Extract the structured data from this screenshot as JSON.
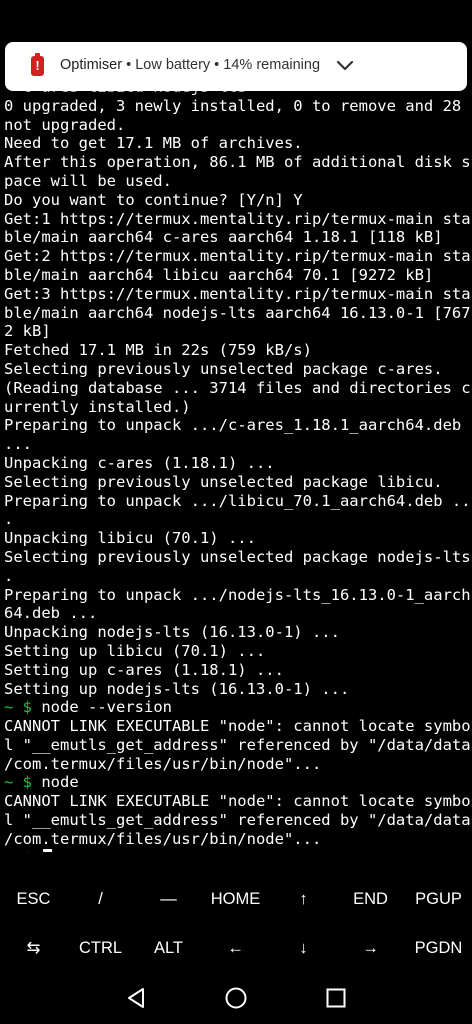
{
  "notification": {
    "app": "Optimiser",
    "separator": " • ",
    "message": "Low battery",
    "detail": "14% remaining",
    "battery_glyph": "!"
  },
  "terminal": {
    "lines": [
      "  c-ares libicu nodejs-lts",
      "0 upgraded, 3 newly installed, 0 to remove and 28",
      "not upgraded.",
      "Need to get 17.1 MB of archives.",
      "After this operation, 86.1 MB of additional disk s",
      "pace will be used.",
      "Do you want to continue? [Y/n] Y",
      "Get:1 https://termux.mentality.rip/termux-main sta",
      "ble/main aarch64 c-ares aarch64 1.18.1 [118 kB]",
      "Get:2 https://termux.mentality.rip/termux-main sta",
      "ble/main aarch64 libicu aarch64 70.1 [9272 kB]",
      "Get:3 https://termux.mentality.rip/termux-main sta",
      "ble/main aarch64 nodejs-lts aarch64 16.13.0-1 [767",
      "2 kB]",
      "Fetched 17.1 MB in 22s (759 kB/s)",
      "Selecting previously unselected package c-ares.",
      "(Reading database ... 3714 files and directories c",
      "urrently installed.)",
      "Preparing to unpack .../c-ares_1.18.1_aarch64.deb",
      "...",
      "Unpacking c-ares (1.18.1) ...",
      "Selecting previously unselected package libicu.",
      "Preparing to unpack .../libicu_70.1_aarch64.deb ..",
      ".",
      "Unpacking libicu (70.1) ...",
      "Selecting previously unselected package nodejs-lts",
      ".",
      "Preparing to unpack .../nodejs-lts_16.13.0-1_aarch",
      "64.deb ...",
      "Unpacking nodejs-lts (16.13.0-1) ...",
      "Setting up libicu (70.1) ...",
      "Setting up c-ares (1.18.1) ...",
      "Setting up nodejs-lts (16.13.0-1) ..."
    ],
    "prompt_symbol": "~ $",
    "cmd1": "node --version",
    "error1_lines": [
      "CANNOT LINK EXECUTABLE \"node\": cannot locate symbo",
      "l \"__emutls_get_address\" referenced by \"/data/data",
      "/com.termux/files/usr/bin/node\"..."
    ],
    "cmd2": "node",
    "error2_lines": [
      "CANNOT LINK EXECUTABLE \"node\": cannot locate symbo",
      "l \"__emutls_get_address\" referenced by \"/data/data",
      "/com.termux/files/usr/bin/node\"..."
    ]
  },
  "extra_keys": {
    "row1": [
      "ESC",
      "/",
      "—",
      "HOME",
      "↑",
      "END",
      "PGUP"
    ],
    "row2": [
      "⇆",
      "CTRL",
      "ALT",
      "←",
      "↓",
      "→",
      "PGDN"
    ]
  },
  "colors": {
    "prompt": "#1cc23a",
    "battery_warning": "#d32020"
  }
}
